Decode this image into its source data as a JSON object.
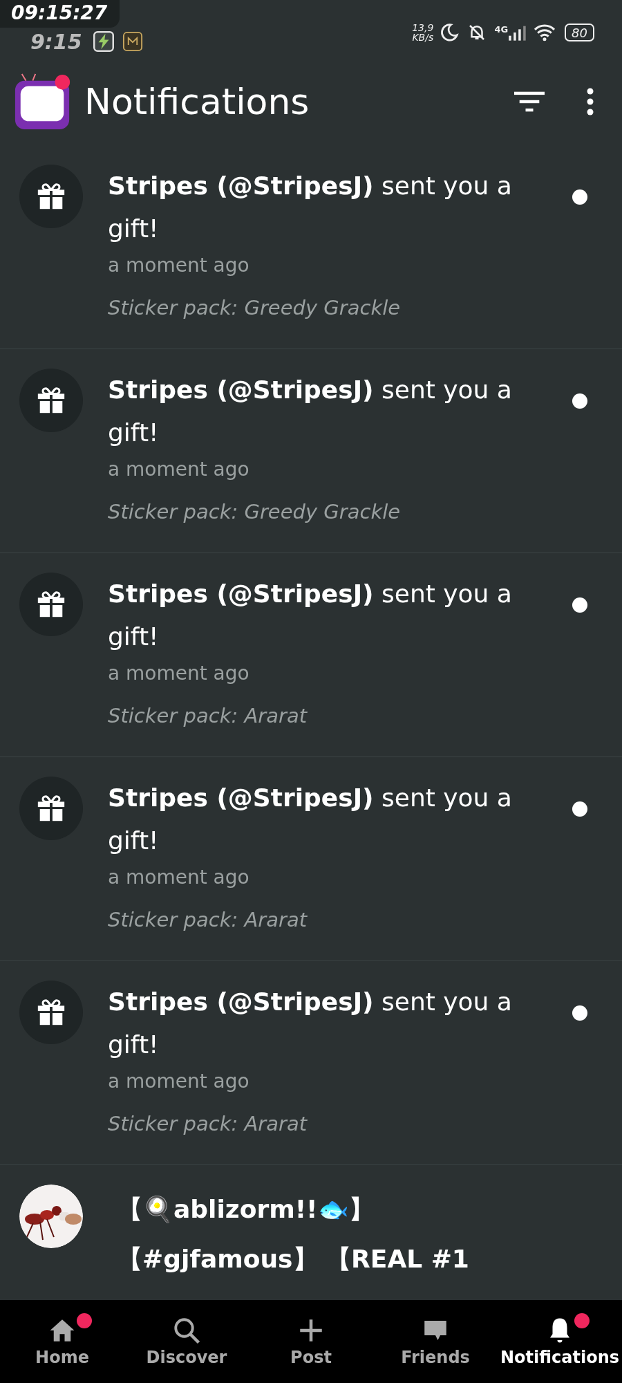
{
  "status_bar": {
    "recorder_time": "09:15:27",
    "time": "9:15",
    "net_speed": "13,9",
    "net_unit": "KB/s",
    "network": "4G",
    "battery": "80"
  },
  "header": {
    "title": "Notifications",
    "logo_badge": true
  },
  "notifications": [
    {
      "kind": "gift",
      "text": "**Stripes (@StripesJ)** sent you a gift!",
      "time": "a moment ago",
      "detail": "Sticker pack: Greedy Grackle",
      "unread": true
    },
    {
      "kind": "gift",
      "text": "**Stripes (@StripesJ)** sent you a gift!",
      "time": "a moment ago",
      "detail": "Sticker pack: Greedy Grackle",
      "unread": true
    },
    {
      "kind": "gift",
      "text": "**Stripes (@StripesJ)** sent you a gift!",
      "time": "a moment ago",
      "detail": "Sticker pack: Ararat",
      "unread": true
    },
    {
      "kind": "gift",
      "text": "**Stripes (@StripesJ)** sent you a gift!",
      "time": "a moment ago",
      "detail": "Sticker pack: Ararat",
      "unread": true
    },
    {
      "kind": "gift",
      "text": "**Stripes (@StripesJ)** sent you a gift!",
      "time": "a moment ago",
      "detail": "Sticker pack: Ararat",
      "unread": true
    },
    {
      "kind": "user",
      "text": "**【🍳ablizorm!!🐟】【#gjfamous】 【REAL #1**",
      "unread": false
    }
  ],
  "nav": [
    {
      "kind": "home",
      "label": "Home",
      "selected": false,
      "badge": true
    },
    {
      "kind": "discover",
      "label": "Discover",
      "selected": false,
      "badge": false
    },
    {
      "kind": "post",
      "label": "Post",
      "selected": false,
      "badge": false
    },
    {
      "kind": "friends",
      "label": "Friends",
      "selected": false,
      "badge": false
    },
    {
      "kind": "notifications",
      "label": "Notifications",
      "selected": true,
      "badge": true
    }
  ]
}
